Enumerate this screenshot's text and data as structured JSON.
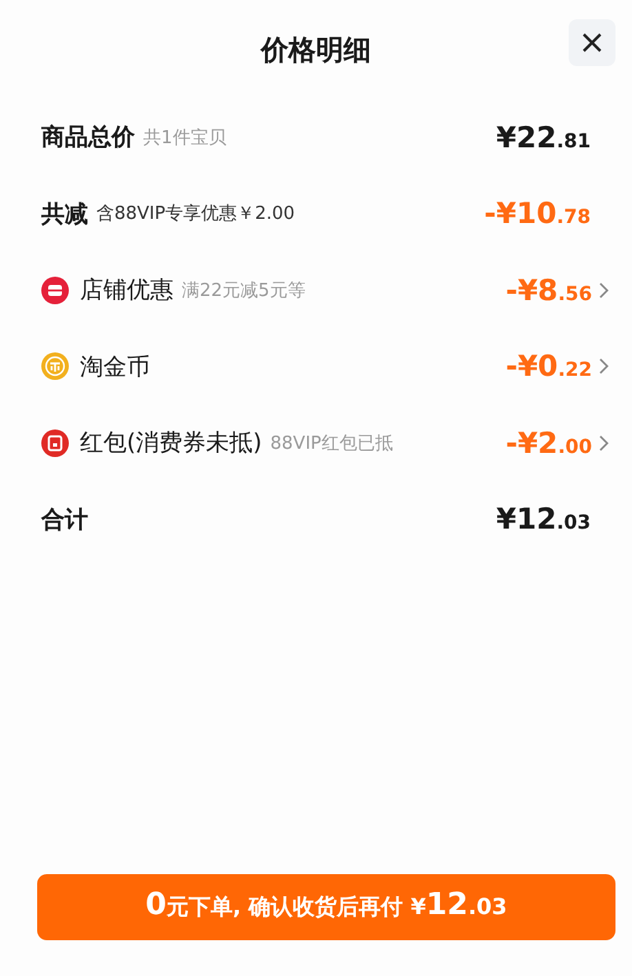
{
  "title": "价格明细",
  "rows": [
    {
      "kind": "plain",
      "label": "商品总价",
      "note": "共1件宝贝",
      "amount_main": "¥22",
      "amount_cents": ".81",
      "color": "#1a1a1a",
      "chevron": false
    },
    {
      "kind": "plain",
      "label": "共减",
      "note": "含88VIP专享优惠￥2.00",
      "amount_main": "-¥10",
      "amount_cents": ".78",
      "color": "#ff6a13",
      "chevron": false
    },
    {
      "kind": "shop",
      "label": "店铺优惠",
      "note": "满22元减5元等",
      "amount_main": "-¥8",
      "amount_cents": ".56",
      "color": "#ff6a13",
      "chevron": true
    },
    {
      "kind": "coin",
      "label": "淘金币",
      "amount_main": "-¥0",
      "amount_cents": ".22",
      "color": "#ff6a13",
      "chevron": true
    },
    {
      "kind": "envelope",
      "label": "红包(消费券未抵)",
      "note": "88VIP红包已抵",
      "amount_main": "-¥2",
      "amount_cents": ".00",
      "color": "#ff6a13",
      "chevron": true
    },
    {
      "kind": "total",
      "label": "合计",
      "amount_main": "¥12",
      "amount_cents": ".03",
      "color": "#1a1a1a",
      "chevron": false
    }
  ],
  "button": {
    "parts": [
      {
        "text": "0",
        "large": true
      },
      {
        "text": "元下单, 确认收货后再付 ¥",
        "large": false
      },
      {
        "text": "12",
        "large": true
      },
      {
        "text": ".03",
        "large": false
      }
    ]
  }
}
